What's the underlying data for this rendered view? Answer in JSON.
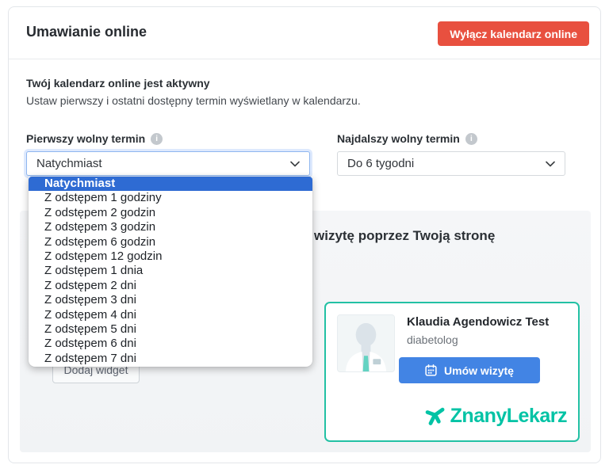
{
  "header": {
    "title": "Umawianie online",
    "disable_button": "Wyłącz kalendarz online"
  },
  "status": {
    "heading": "Twój kalendarz online jest aktywny",
    "description": "Ustaw pierwszy i ostatni dostępny termin wyświetlany w kalendarzu."
  },
  "first_slot": {
    "label": "Pierwszy wolny termin",
    "info_icon": "i",
    "value": "Natychmiast",
    "selected_index": 0,
    "options": [
      "Natychmiast",
      "Z odstępem 1 godziny",
      "Z odstępem 2 godzin",
      "Z odstępem 3 godzin",
      "Z odstępem 6 godzin",
      "Z odstępem 12 godzin",
      "Z odstępem 1 dnia",
      "Z odstępem 2 dni",
      "Z odstępem 3 dni",
      "Z odstępem 4 dni",
      "Z odstępem 5 dni",
      "Z odstępem 6 dni",
      "Z odstępem 7 dni"
    ]
  },
  "furthest_slot": {
    "label": "Najdalszy wolny termin",
    "info_icon": "i",
    "value": "Do 6 tygodni"
  },
  "widget_section": {
    "heading_visible": "wizytę poprzez Twoją stronę",
    "add_widget_button": "Dodaj widget"
  },
  "doctor_card": {
    "name": "Klaudia Agendowicz Test",
    "specialty": "diabetolog",
    "book_button": "Umów wizytę",
    "logo_text": "ZnanyLekarz"
  },
  "colors": {
    "danger_button": "#e8503f",
    "primary_button": "#4284e4",
    "dropdown_highlight": "#2e6bd3",
    "brand_teal": "#00c3a5",
    "card_border_teal": "#23c1a4",
    "focus_border": "#8fb6ef"
  }
}
